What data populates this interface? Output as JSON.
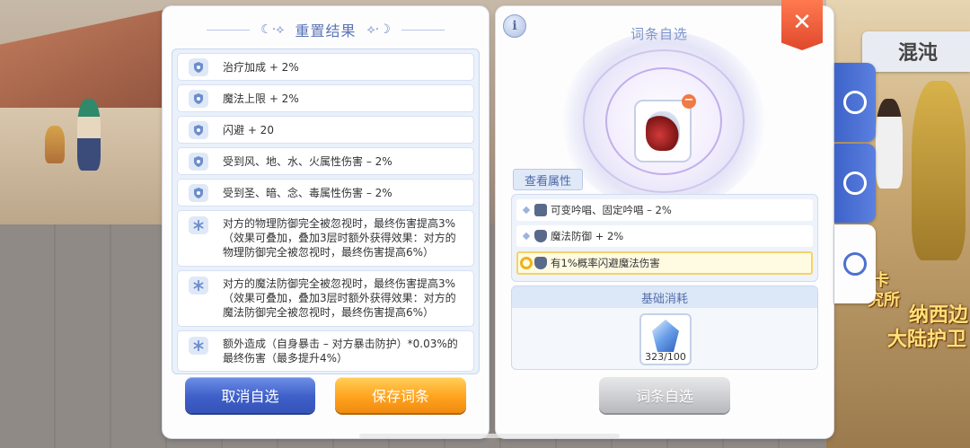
{
  "left_panel": {
    "title": "重置结果",
    "rows": [
      {
        "text": "治疗加成 + 2%",
        "icon": "shield-icon"
      },
      {
        "text": "魔法上限 + 2%",
        "icon": "shield-icon"
      },
      {
        "text": "闪避 + 20",
        "icon": "shield-icon"
      },
      {
        "text": "受到风、地、水、火属性伤害 – 2%",
        "icon": "shield-icon"
      },
      {
        "text": "受到圣、暗、念、毒属性伤害 – 2%",
        "icon": "shield-icon"
      },
      {
        "text": "对方的物理防御完全被忽视时，最终伤害提高3%（效果可叠加，叠加3层时额外获得效果：对方的物理防御完全被忽视时，最终伤害提高6%）",
        "icon": "snowflake-icon"
      },
      {
        "text": "对方的魔法防御完全被忽视时，最终伤害提高3%（效果可叠加，叠加3层时额外获得效果：对方的魔法防御完全被忽视时，最终伤害提高6%）",
        "icon": "snowflake-icon"
      },
      {
        "text": "额外造成（自身暴击 – 对方暴击防护）*0.03%的最终伤害（最多提升4%）",
        "icon": "snowflake-icon"
      }
    ],
    "cancel_label": "取消自选",
    "save_label": "保存词条"
  },
  "right_panel": {
    "info_label": "i",
    "title": "词条自选",
    "close_label": "✕",
    "remove_label": "−",
    "view_attr_label": "查看属性",
    "attributes": [
      {
        "text": "可变吟唱、固定吟唱 – 2%"
      },
      {
        "text": "魔法防御 + 2%"
      },
      {
        "text": "有1%概率闪避魔法伤害"
      }
    ],
    "cost_title": "基础消耗",
    "cost_count": "323/100",
    "select_label": "词条自选"
  },
  "background": {
    "sign_text": "混沌",
    "text_lines": [
      "卡",
      "究所",
      "纳西边",
      "大陆护卫"
    ]
  },
  "colors": {
    "accent_blue": "#3f5fc9",
    "accent_orange": "#ffa31e",
    "close_red": "#e0482c"
  }
}
